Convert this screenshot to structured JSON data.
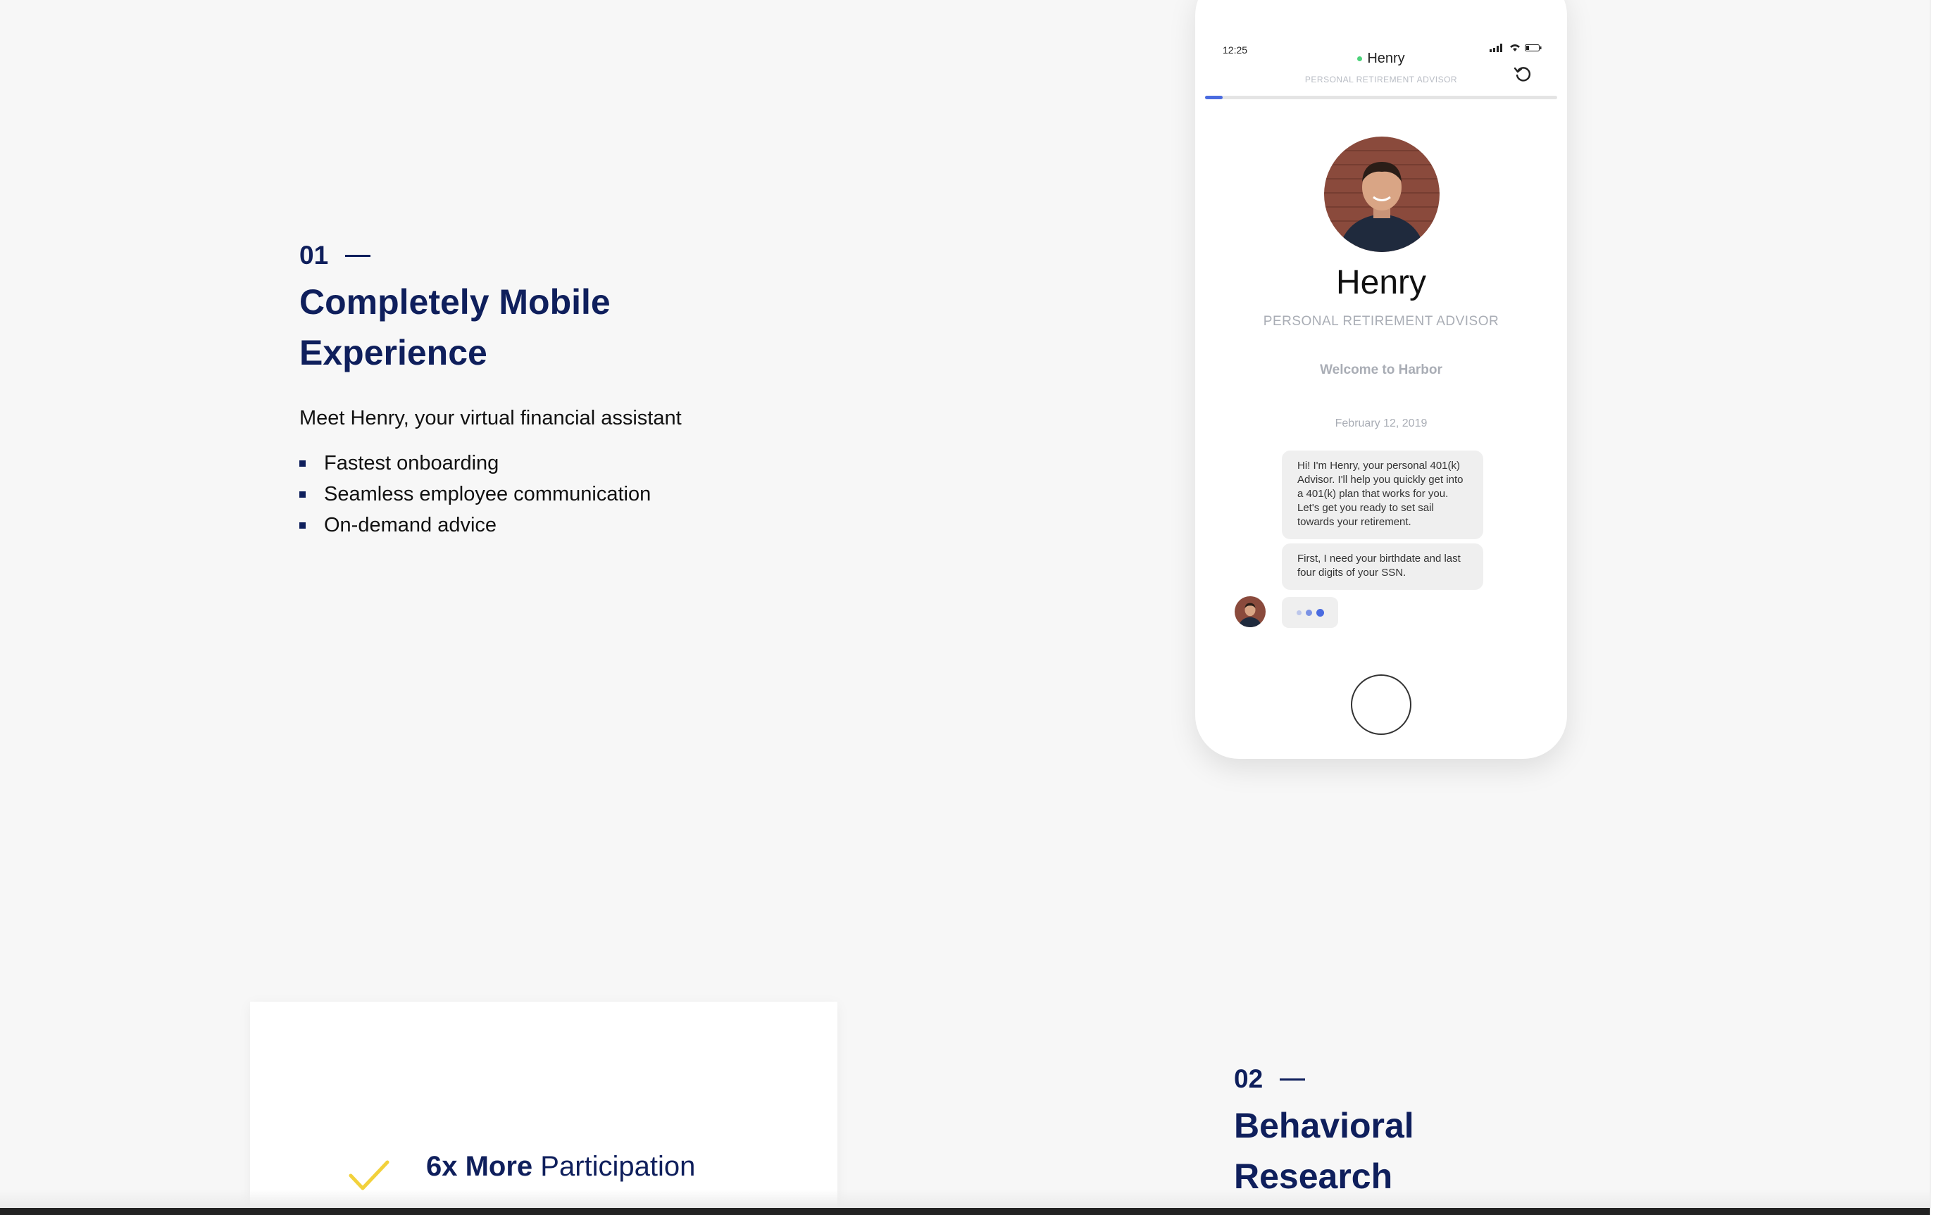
{
  "section1": {
    "number": "01",
    "title_line1": "Completely Mobile",
    "title_line2": "Experience",
    "lead": "Meet Henry, your virtual financial assistant",
    "bullets": [
      "Fastest onboarding",
      "Seamless employee communication",
      "On-demand advice"
    ]
  },
  "phone": {
    "status_time": "12:25",
    "header_name": "Henry",
    "header_subtitle": "PERSONAL RETIREMENT ADVISOR",
    "progress_fraction": 0.05,
    "profile_name": "Henry",
    "profile_role": "PERSONAL RETIREMENT ADVISOR",
    "welcome": "Welcome to Harbor",
    "date": "February 12, 2019",
    "messages": [
      "Hi! I'm Henry, your personal 401(k) Advisor. I'll help you quickly get into a 401(k) plan that works for you. Let's get you ready to set sail towards your retirement.",
      "First, I need your birthdate and last four digits of your SSN."
    ]
  },
  "card": {
    "stat_bold": "6x More",
    "stat_rest": "Participation"
  },
  "section2": {
    "number": "02",
    "title_line1": "Behavioral",
    "title_line2": "Research"
  },
  "colors": {
    "navy": "#0f1f5c",
    "accent_blue": "#4a6be0",
    "check_yellow": "#f2d13c",
    "online_green": "#4cd37a"
  }
}
